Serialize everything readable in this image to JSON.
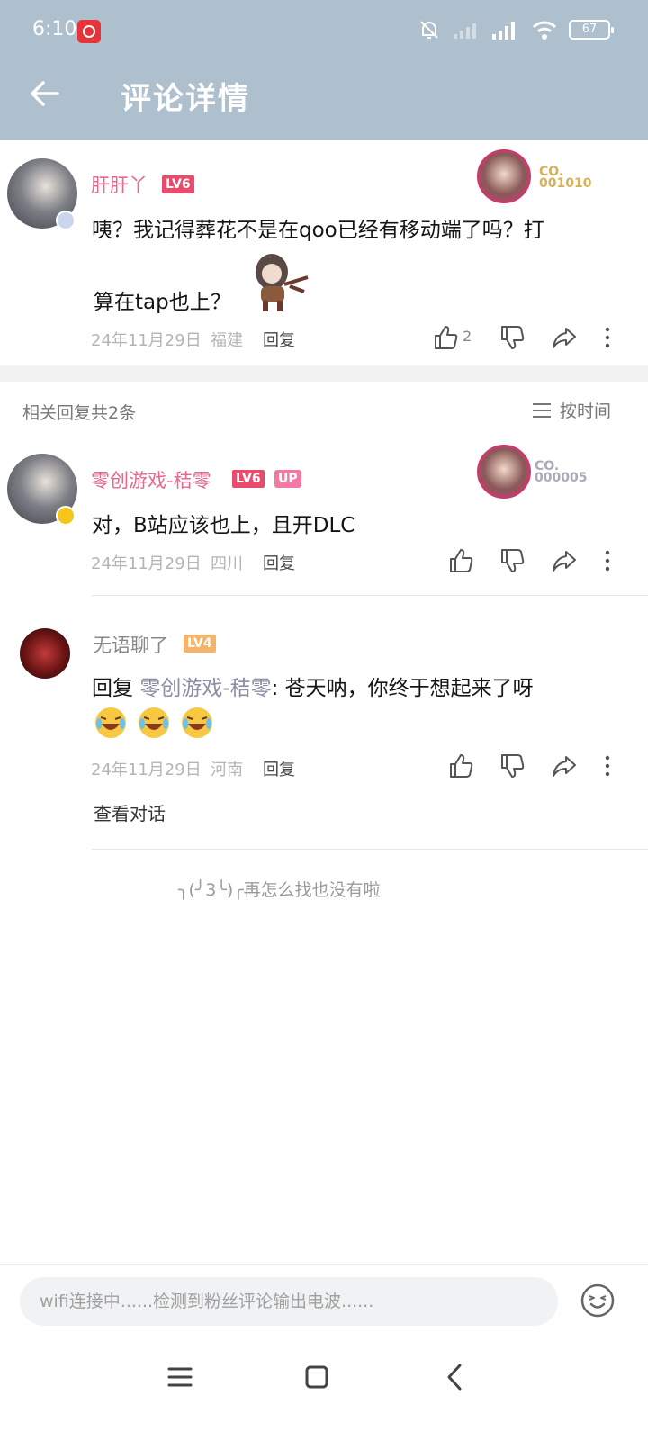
{
  "status_bar": {
    "time": "6:10",
    "battery": "67"
  },
  "header": {
    "title": "评论详情"
  },
  "main_comment": {
    "username": "肝肝丫",
    "level": "LV6",
    "deco_label": "CO.",
    "deco_number": "001010",
    "text_line1": "咦？我记得葬花不是在qoo已经有移动端了吗？打",
    "text_line2": "算在tap也上？",
    "date": "24年11月29日",
    "location": "福建",
    "reply_label": "回复",
    "like_count": "2"
  },
  "replies_header": {
    "count_text": "相关回复共2条",
    "sort_label": "按时间"
  },
  "replies": [
    {
      "username": "零创游戏-秸零",
      "level": "LV6",
      "up_badge": "UP",
      "deco_label": "CO.",
      "deco_number": "000005",
      "text": "对，B站应该也上，且开DLC",
      "date": "24年11月29日",
      "location": "四川",
      "reply_label": "回复"
    },
    {
      "username": "无语聊了",
      "level": "LV4",
      "text_prefix": "回复 ",
      "reply_to": "零创游戏-秸零",
      "text_body": ": 苍天呐，你终于想起来了呀",
      "date": "24年11月29日",
      "location": "河南",
      "reply_label": "回复",
      "view_conversation": "查看对话"
    }
  ],
  "end_text": "╮(╯3╰)╭再怎么找也没有啦",
  "comment_input": {
    "placeholder": "wifi连接中......检测到粉丝评论输出电波......"
  },
  "colors": {
    "header_bg": "#aebfcd",
    "username_pink": "#e5698d",
    "lv6": "#e84b6b",
    "lv4": "#f5b46b"
  }
}
